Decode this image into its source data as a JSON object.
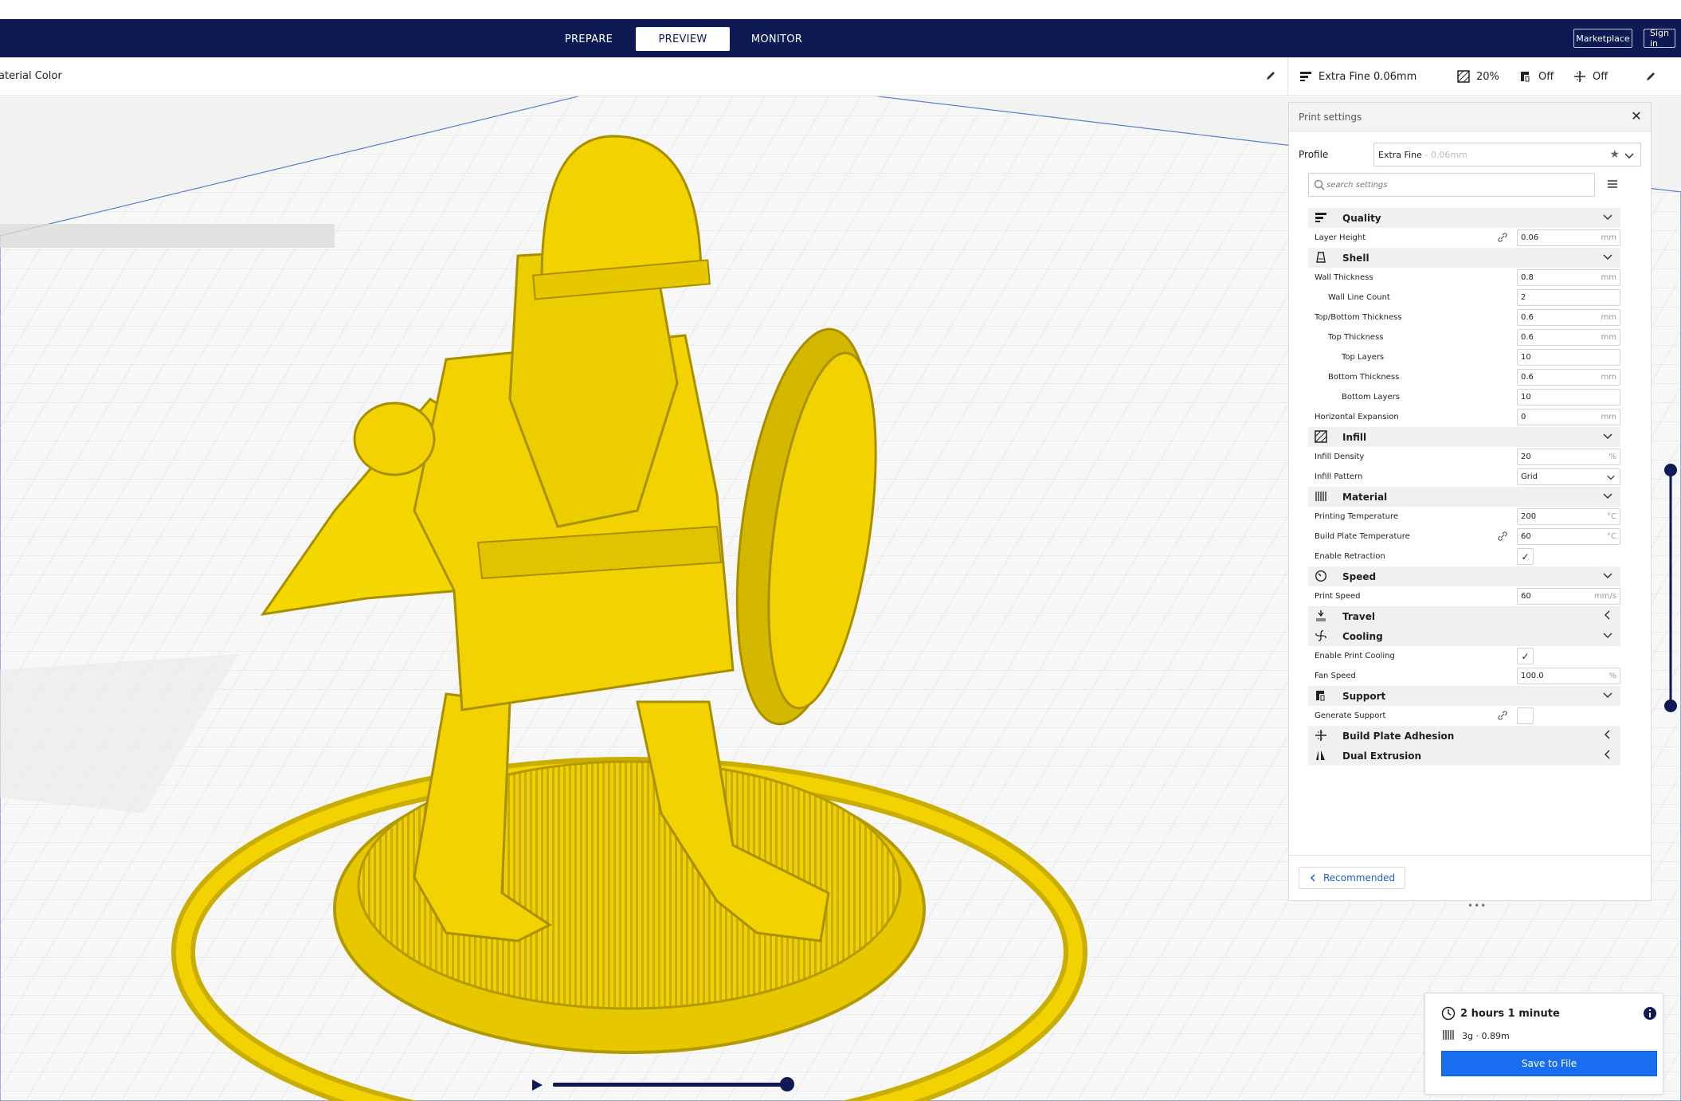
{
  "header": {
    "stages": [
      {
        "label": "PREPARE"
      },
      {
        "label": "PREVIEW"
      },
      {
        "label": "MONITOR"
      }
    ],
    "marketplace_label": "Marketplace",
    "signin_label": "Sign in"
  },
  "view": {
    "color_scheme_label": "aterial Color"
  },
  "settings_bar": {
    "profile": "Extra Fine 0.06mm",
    "infill": "20%",
    "support": "Off",
    "adhesion": "Off"
  },
  "panel": {
    "title": "Print settings",
    "profile_label": "Profile",
    "profile_name": "Extra Fine",
    "profile_sub": " - 0.06mm",
    "search_placeholder": "search settings",
    "recommended_label": "Recommended",
    "grip": "•••",
    "categories": [
      {
        "name": "Quality",
        "icon": "quality-icon",
        "state": "expanded"
      },
      {
        "name": "Shell",
        "icon": "shell-icon",
        "state": "expanded"
      },
      {
        "name": "Infill",
        "icon": "infill-icon",
        "state": "expanded"
      },
      {
        "name": "Material",
        "icon": "material-icon",
        "state": "expanded"
      },
      {
        "name": "Speed",
        "icon": "speed-icon",
        "state": "expanded"
      },
      {
        "name": "Travel",
        "icon": "travel-icon",
        "state": "collapsed"
      },
      {
        "name": "Cooling",
        "icon": "cooling-icon",
        "state": "expanded"
      },
      {
        "name": "Support",
        "icon": "support-icon",
        "state": "expanded"
      },
      {
        "name": "Build Plate Adhesion",
        "icon": "adhesion-icon",
        "state": "collapsed"
      },
      {
        "name": "Dual Extrusion",
        "icon": "dual-extrusion-icon",
        "state": "collapsed"
      }
    ],
    "settings": {
      "layer_height": {
        "label": "Layer Height",
        "value": "0.06",
        "unit": "mm"
      },
      "wall_thickness": {
        "label": "Wall Thickness",
        "value": "0.8",
        "unit": "mm"
      },
      "wall_line_count": {
        "label": "Wall Line Count",
        "value": "2",
        "unit": ""
      },
      "top_bottom_thickness": {
        "label": "Top/Bottom Thickness",
        "value": "0.6",
        "unit": "mm"
      },
      "top_thickness": {
        "label": "Top Thickness",
        "value": "0.6",
        "unit": "mm"
      },
      "top_layers": {
        "label": "Top Layers",
        "value": "10",
        "unit": ""
      },
      "bottom_thickness": {
        "label": "Bottom Thickness",
        "value": "0.6",
        "unit": "mm"
      },
      "bottom_layers": {
        "label": "Bottom Layers",
        "value": "10",
        "unit": ""
      },
      "horizontal_expansion": {
        "label": "Horizontal Expansion",
        "value": "0",
        "unit": "mm"
      },
      "infill_density": {
        "label": "Infill Density",
        "value": "20",
        "unit": "%"
      },
      "infill_pattern": {
        "label": "Infill Pattern",
        "value": "Grid"
      },
      "printing_temperature": {
        "label": "Printing Temperature",
        "value": "200",
        "unit": "°C"
      },
      "build_plate_temperature": {
        "label": "Build Plate Temperature",
        "value": "60",
        "unit": "°C"
      },
      "enable_retraction": {
        "label": "Enable Retraction",
        "checked": true
      },
      "print_speed": {
        "label": "Print Speed",
        "value": "60",
        "unit": "mm/s"
      },
      "enable_print_cooling": {
        "label": "Enable Print Cooling",
        "checked": true
      },
      "fan_speed": {
        "label": "Fan Speed",
        "value": "100.0",
        "unit": "%"
      },
      "generate_support": {
        "label": "Generate Support",
        "checked": false
      }
    }
  },
  "job": {
    "time": "2 hours 1 minute",
    "material": "3g · 0.89m",
    "save_label": "Save to File"
  },
  "colors": {
    "header_bg": "#0f1a54",
    "accent_blue": "#196ef0",
    "model_yellow": "#f2d200",
    "model_shadow": "#b39a00"
  }
}
